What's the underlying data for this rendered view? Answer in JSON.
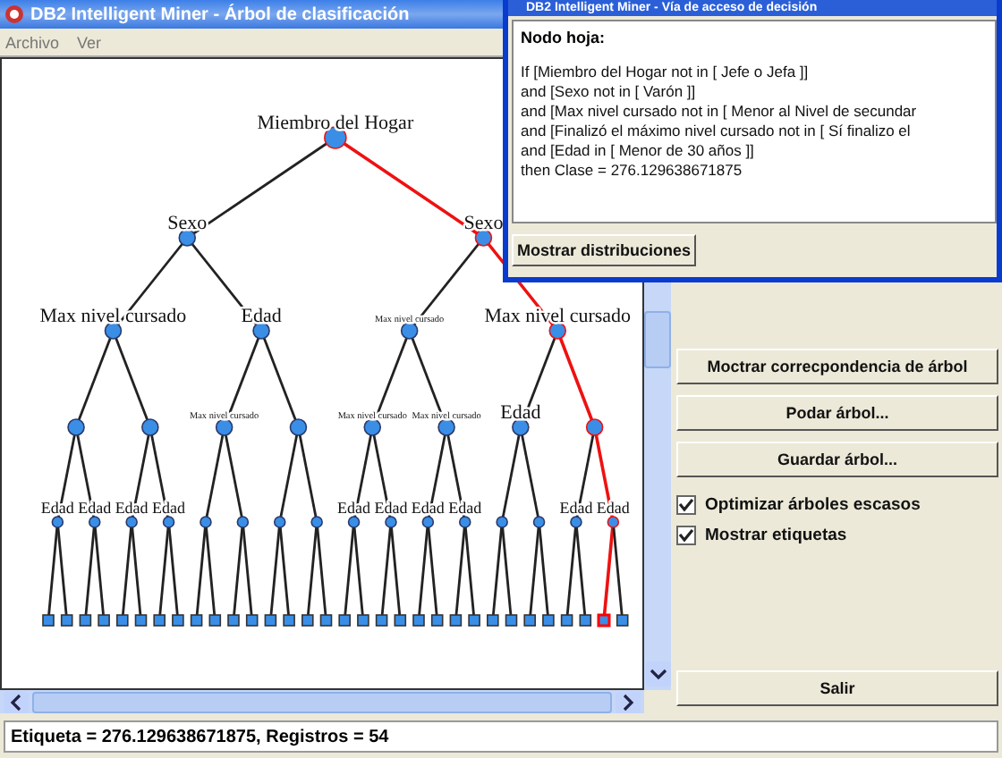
{
  "window": {
    "title": "DB2 Intelligent Miner - Árbol de clasificación"
  },
  "menu": [
    "Archivo",
    "Ver"
  ],
  "tree": {
    "label": "Miembro del Hogar",
    "kind": "split",
    "selected": true,
    "children": [
      {
        "label": "Sexo",
        "kind": "split",
        "selected": false,
        "children": [
          {
            "label": "Max nivel cursado",
            "kind": "split",
            "selected": false,
            "children": [
              {
                "kind": "split",
                "selected": false,
                "children": [
                  {
                    "label": "Edad",
                    "kind": "split",
                    "selected": false,
                    "children": [
                      {
                        "kind": "leaf",
                        "selected": false
                      },
                      {
                        "kind": "leaf",
                        "selected": false
                      }
                    ]
                  },
                  {
                    "label": "Edad",
                    "kind": "split",
                    "selected": false,
                    "children": [
                      {
                        "kind": "leaf",
                        "selected": false
                      },
                      {
                        "kind": "leaf",
                        "selected": false
                      }
                    ]
                  }
                ]
              },
              {
                "kind": "split",
                "selected": false,
                "children": [
                  {
                    "label": "Edad",
                    "kind": "split",
                    "selected": false,
                    "children": [
                      {
                        "kind": "leaf",
                        "selected": false
                      },
                      {
                        "kind": "leaf",
                        "selected": false
                      }
                    ]
                  },
                  {
                    "label": "Edad",
                    "kind": "split",
                    "selected": false,
                    "children": [
                      {
                        "kind": "leaf",
                        "selected": false
                      },
                      {
                        "kind": "leaf",
                        "selected": false
                      }
                    ]
                  }
                ]
              }
            ]
          },
          {
            "label": "Edad",
            "kind": "split",
            "selected": false,
            "children": [
              {
                "label": "Max nivel cursado",
                "kind": "minor",
                "selected": false,
                "children": [
                  {
                    "kind": "split",
                    "selected": false,
                    "children": [
                      {
                        "kind": "leaf",
                        "selected": false
                      },
                      {
                        "kind": "leaf",
                        "selected": false
                      }
                    ]
                  },
                  {
                    "kind": "split",
                    "selected": false,
                    "children": [
                      {
                        "kind": "leaf",
                        "selected": false
                      },
                      {
                        "kind": "leaf",
                        "selected": false
                      }
                    ]
                  }
                ]
              },
              {
                "kind": "split",
                "selected": false,
                "children": [
                  {
                    "kind": "split",
                    "selected": false,
                    "children": [
                      {
                        "kind": "leaf",
                        "selected": false
                      },
                      {
                        "kind": "leaf",
                        "selected": false
                      }
                    ]
                  },
                  {
                    "kind": "split",
                    "selected": false,
                    "children": [
                      {
                        "kind": "leaf",
                        "selected": false
                      },
                      {
                        "kind": "leaf",
                        "selected": false
                      }
                    ]
                  }
                ]
              }
            ]
          }
        ]
      },
      {
        "label": "Sexo",
        "kind": "split",
        "selected": true,
        "children": [
          {
            "label": "Max nivel cursado",
            "kind": "minor",
            "selected": false,
            "children": [
              {
                "label": "Max nivel cursado",
                "kind": "minor",
                "selected": false,
                "children": [
                  {
                    "label": "Edad",
                    "kind": "split",
                    "selected": false,
                    "children": [
                      {
                        "kind": "leaf",
                        "selected": false
                      },
                      {
                        "kind": "leaf",
                        "selected": false
                      }
                    ]
                  },
                  {
                    "label": "Edad",
                    "kind": "split",
                    "selected": false,
                    "children": [
                      {
                        "kind": "leaf",
                        "selected": false
                      },
                      {
                        "kind": "leaf",
                        "selected": false
                      }
                    ]
                  }
                ]
              },
              {
                "label": "Max nivel cursado",
                "kind": "minor",
                "selected": false,
                "children": [
                  {
                    "label": "Edad",
                    "kind": "split",
                    "selected": false,
                    "children": [
                      {
                        "kind": "leaf",
                        "selected": false
                      },
                      {
                        "kind": "leaf",
                        "selected": false
                      }
                    ]
                  },
                  {
                    "label": "Edad",
                    "kind": "split",
                    "selected": false,
                    "children": [
                      {
                        "kind": "leaf",
                        "selected": false
                      },
                      {
                        "kind": "leaf",
                        "selected": false
                      }
                    ]
                  }
                ]
              }
            ]
          },
          {
            "label": "Max nivel cursado",
            "kind": "split",
            "selected": true,
            "children": [
              {
                "label": "Edad",
                "kind": "split",
                "selected": false,
                "children": [
                  {
                    "kind": "split",
                    "selected": false,
                    "children": [
                      {
                        "kind": "leaf",
                        "selected": false
                      },
                      {
                        "kind": "leaf",
                        "selected": false
                      }
                    ]
                  },
                  {
                    "kind": "split",
                    "selected": false,
                    "children": [
                      {
                        "kind": "leaf",
                        "selected": false
                      },
                      {
                        "kind": "leaf",
                        "selected": false
                      }
                    ]
                  }
                ]
              },
              {
                "kind": "split",
                "selected": true,
                "children": [
                  {
                    "label": "Edad",
                    "kind": "split",
                    "selected": false,
                    "children": [
                      {
                        "kind": "leaf",
                        "selected": false
                      },
                      {
                        "kind": "leaf",
                        "selected": false
                      }
                    ]
                  },
                  {
                    "label": "Edad",
                    "kind": "split",
                    "selected": true,
                    "children": [
                      {
                        "kind": "leaf",
                        "selected": true
                      },
                      {
                        "kind": "leaf",
                        "selected": false
                      }
                    ]
                  }
                ]
              }
            ]
          }
        ]
      }
    ]
  },
  "dialog": {
    "title": "DB2 Intelligent Miner - Vía de acceso de decisión",
    "heading": "Nodo hoja:",
    "rule_lines": [
      "If [Miembro del Hogar not in [ Jefe o Jefa ]]",
      "and [Sexo not in [ Varón ]]",
      "and [Max nivel cursado not in [ Menor al Nivel de secundar",
      "and [Finalizó el máximo nivel cursado not in [ Sí finalizo el",
      "and [Edad in [ Menor de 30 años ]]",
      "then Clase = 276.129638671875"
    ],
    "button": "Mostrar distribuciones"
  },
  "actions": [
    "Moctrar correcpondencia de árbol",
    "Podar árbol...",
    "Guardar árbol..."
  ],
  "options": [
    {
      "label": "Optimizar árboles escasos",
      "checked": true
    },
    {
      "label": "Mostrar etiquetas",
      "checked": true
    }
  ],
  "exit_button": "Salir",
  "status_bar": "Etiqueta = 276.129638671875, Registros = 54"
}
